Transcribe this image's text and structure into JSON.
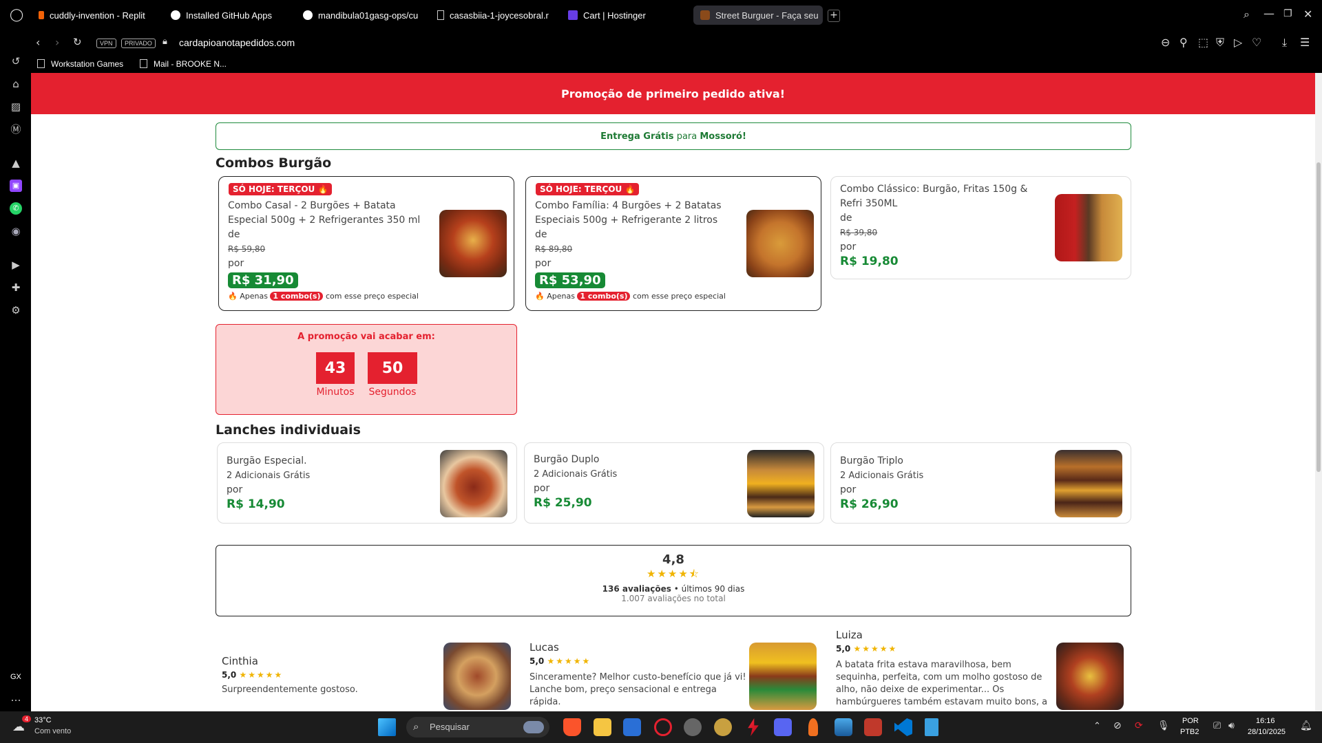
{
  "browser": {
    "tabs": [
      {
        "label": "cuddly-invention - Replit"
      },
      {
        "label": "Installed GitHub Apps"
      },
      {
        "label": "mandibula01gasg-ops/cu"
      },
      {
        "label": "casasbiia-1-joycesobral.r"
      },
      {
        "label": "Cart | Hostinger"
      },
      {
        "label": "Street Burguer - Faça seu"
      }
    ],
    "vpn_label": "VPN",
    "private_label": "PRIVADO",
    "url": "cardapioanotapedidos.com",
    "bookmarks": [
      {
        "label": "Workstation Games"
      },
      {
        "label": "Mail - BROOKE N..."
      }
    ],
    "sidebar_bottom": "GX"
  },
  "page": {
    "banner": "Promoção de primeiro pedido ativa!",
    "delivery": {
      "prefix": "Entrega Grátis",
      "middle": "para",
      "city": "Mossoró!"
    },
    "combos_title": "Combos Burgão",
    "combos": [
      {
        "badge": "SÓ HOJE: TERÇOU 🔥",
        "name": "Combo Casal - 2 Burgões + Batata Especial 500g + 2 Refrigerantes 350 ml",
        "de": "de",
        "old_price": "R$ 59,80",
        "por": "por",
        "price": "R$ 31,90",
        "note_pre": "Apenas",
        "note_pill": "1 combo(s)",
        "note_post": "com esse preço especial"
      },
      {
        "badge": "SÓ HOJE: TERÇOU 🔥",
        "name": "Combo Família: 4 Burgões + 2 Batatas Especiais 500g + Refrigerante 2 litros",
        "de": "de",
        "old_price": "R$ 89,80",
        "por": "por",
        "price": "R$ 53,90",
        "note_pre": "Apenas",
        "note_pill": "1 combo(s)",
        "note_post": "com esse preço especial"
      },
      {
        "name": "Combo Clássico: Burgão, Fritas 150g & Refri 350ML",
        "de": "de",
        "old_price": "R$ 39,80",
        "por": "por",
        "price": "R$ 19,80"
      }
    ],
    "countdown": {
      "title": "A promoção vai acabar em:",
      "minutes": "43",
      "minutes_label": "Minutos",
      "seconds": "50",
      "seconds_label": "Segundos"
    },
    "individuais_title": "Lanches individuais",
    "lanches": [
      {
        "name": "Burgão Especial.",
        "sub": "2 Adicionais Grátis",
        "por": "por",
        "price": "R$ 14,90"
      },
      {
        "name": "Burgão Duplo",
        "sub": "2 Adicionais Grátis",
        "por": "por",
        "price": "R$ 25,90"
      },
      {
        "name": "Burgão Triplo",
        "sub": "2 Adicionais Grátis",
        "por": "por",
        "price": "R$ 26,90"
      }
    ],
    "rating": {
      "score": "4,8",
      "stars": "★★★★⯪",
      "count": "136 avaliações",
      "period": "• últimos 90 dias",
      "total": "1.007 avaliações no total"
    },
    "reviews": [
      {
        "name": "Cinthia",
        "score": "5,0",
        "stars": "★★★★★",
        "text": "Surpreendentemente gostoso."
      },
      {
        "name": "Lucas",
        "score": "5,0",
        "stars": "★★★★★",
        "text": "Sinceramente? Melhor custo-benefício que já vi! Lanche bom, preço sensacional e entrega rápida."
      },
      {
        "name": "Luiza",
        "score": "5,0",
        "stars": "★★★★★",
        "text": "A batata frita estava maravilhosa, bem sequinha, perfeita, com um molho gostoso de alho, não deixe de experimentar... Os hambúrgueres também estavam muito bons, a"
      }
    ]
  },
  "taskbar": {
    "weather_temp": "33°C",
    "weather_desc": "Com vento",
    "weather_badge": "4",
    "search_placeholder": "Pesquisar",
    "lang_top": "POR",
    "lang_bottom": "PTB2",
    "time": "16:16",
    "date": "28/10/2025"
  }
}
